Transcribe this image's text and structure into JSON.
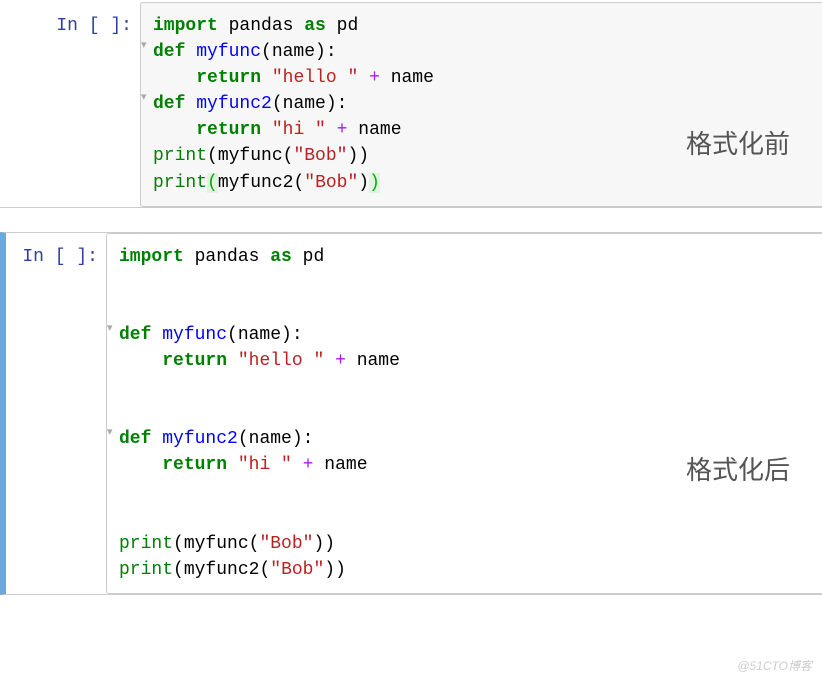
{
  "labels": {
    "before": "格式化前",
    "after": "格式化后"
  },
  "watermark": "@51CTO博客",
  "cells": [
    {
      "prompt": "In [ ]:",
      "folds": [
        {
          "line": 1
        },
        {
          "line": 3
        }
      ],
      "code": {
        "l0": {
          "kw1": "import",
          "mod": "pandas",
          "kw2": "as",
          "alias": "pd"
        },
        "l1": {
          "kw": "def",
          "fn": "myfunc",
          "args": "(name):"
        },
        "l2": {
          "kw": "return",
          "str": "\"hello \"",
          "op": "+",
          "var": "name"
        },
        "l3": {
          "kw": "def",
          "fn": "myfunc2",
          "args": "(name):"
        },
        "l4": {
          "kw": "return",
          "str": "\"hi \"",
          "op": "+",
          "var": "name"
        },
        "l5": {
          "fn1": "print",
          "po": "(",
          "fn2": "myfunc",
          "pi": "(",
          "str": "\"Bob\"",
          "pc": ")",
          "pc2": ")"
        },
        "l6": {
          "fn1": "print",
          "po": "(",
          "fn2": "myfunc2",
          "pi": "(",
          "str": "\"Bob\"",
          "pc": ")",
          "pc2": ")"
        }
      }
    },
    {
      "prompt": "In [ ]:",
      "folds": [
        {
          "line": 3
        },
        {
          "line": 7
        }
      ],
      "code": {
        "l0": {
          "kw1": "import",
          "mod": "pandas",
          "kw2": "as",
          "alias": "pd"
        },
        "l1": {
          "blank": " "
        },
        "l2": {
          "blank": " "
        },
        "l3": {
          "kw": "def",
          "fn": "myfunc",
          "args": "(name):"
        },
        "l4": {
          "kw": "return",
          "str": "\"hello \"",
          "op": "+",
          "var": "name"
        },
        "l5": {
          "blank": " "
        },
        "l6": {
          "blank": " "
        },
        "l7": {
          "kw": "def",
          "fn": "myfunc2",
          "args": "(name):"
        },
        "l8": {
          "kw": "return",
          "str": "\"hi \"",
          "op": "+",
          "var": "name"
        },
        "l9": {
          "blank": " "
        },
        "l10": {
          "blank": " "
        },
        "l11": {
          "fn1": "print",
          "po": "(",
          "fn2": "myfunc",
          "pi": "(",
          "str": "\"Bob\"",
          "pc": ")",
          "pc2": ")"
        },
        "l12": {
          "fn1": "print",
          "po": "(",
          "fn2": "myfunc2",
          "pi": "(",
          "str": "\"Bob\"",
          "pc": ")",
          "pc2": ")"
        }
      }
    }
  ]
}
